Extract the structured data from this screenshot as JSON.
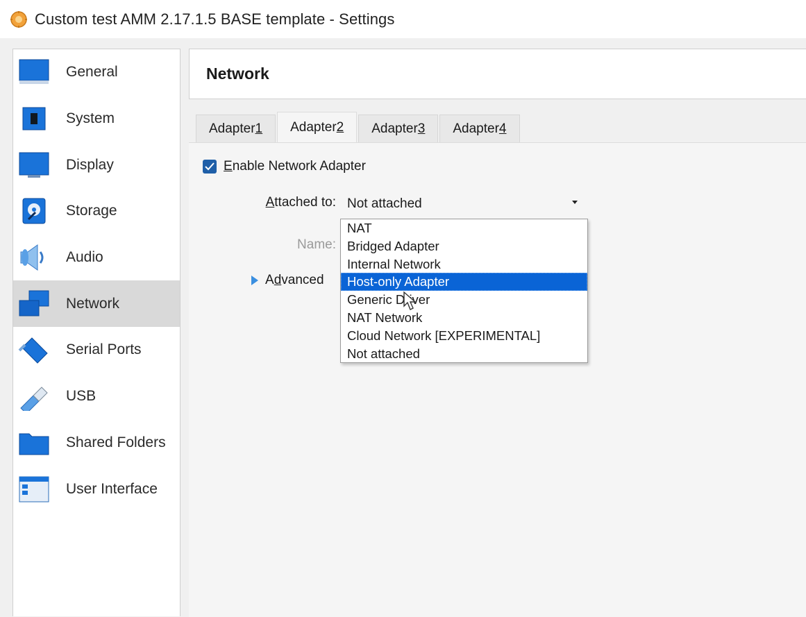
{
  "window": {
    "title": "Custom test AMM 2.17.1.5 BASE template - Settings"
  },
  "sidebar": {
    "items": [
      {
        "label": "General",
        "icon": "monitor-icon",
        "selected": false
      },
      {
        "label": "System",
        "icon": "chip-icon",
        "selected": false
      },
      {
        "label": "Display",
        "icon": "display-icon",
        "selected": false
      },
      {
        "label": "Storage",
        "icon": "disk-icon",
        "selected": false
      },
      {
        "label": "Audio",
        "icon": "speaker-icon",
        "selected": false
      },
      {
        "label": "Network",
        "icon": "network-icon",
        "selected": true
      },
      {
        "label": "Serial Ports",
        "icon": "serial-port-icon",
        "selected": false
      },
      {
        "label": "USB",
        "icon": "usb-icon",
        "selected": false
      },
      {
        "label": "Shared Folders",
        "icon": "folder-icon",
        "selected": false
      },
      {
        "label": "User Interface",
        "icon": "window-icon",
        "selected": false
      }
    ]
  },
  "header": {
    "title": "Network"
  },
  "tabs": [
    {
      "label": "Adapter ",
      "mnemonic": "1",
      "active": false
    },
    {
      "label": "Adapter ",
      "mnemonic": "2",
      "active": true
    },
    {
      "label": "Adapter ",
      "mnemonic": "3",
      "active": false
    },
    {
      "label": "Adapter ",
      "mnemonic": "4",
      "active": false
    }
  ],
  "adapter": {
    "enable_label_mnemonic": "E",
    "enable_label_rest": "nable Network Adapter",
    "enabled": true,
    "attached_label_mnemonic": "A",
    "attached_label_rest": "ttached to:",
    "attached_value": "Not attached",
    "name_label": "Name:",
    "advanced_pre": "A",
    "advanced_mnemonic": "d",
    "advanced_rest": "vanced"
  },
  "dropdown": {
    "options": [
      "NAT",
      "Bridged Adapter",
      "Internal Network",
      "Host-only Adapter",
      "Generic Driver",
      "NAT Network",
      "Cloud Network [EXPERIMENTAL]",
      "Not attached"
    ],
    "highlighted": "Host-only Adapter"
  },
  "colors": {
    "accent": "#0a64d6",
    "selected_sidebar": "#d9d9d9",
    "checkbox": "#1f5fa8"
  }
}
